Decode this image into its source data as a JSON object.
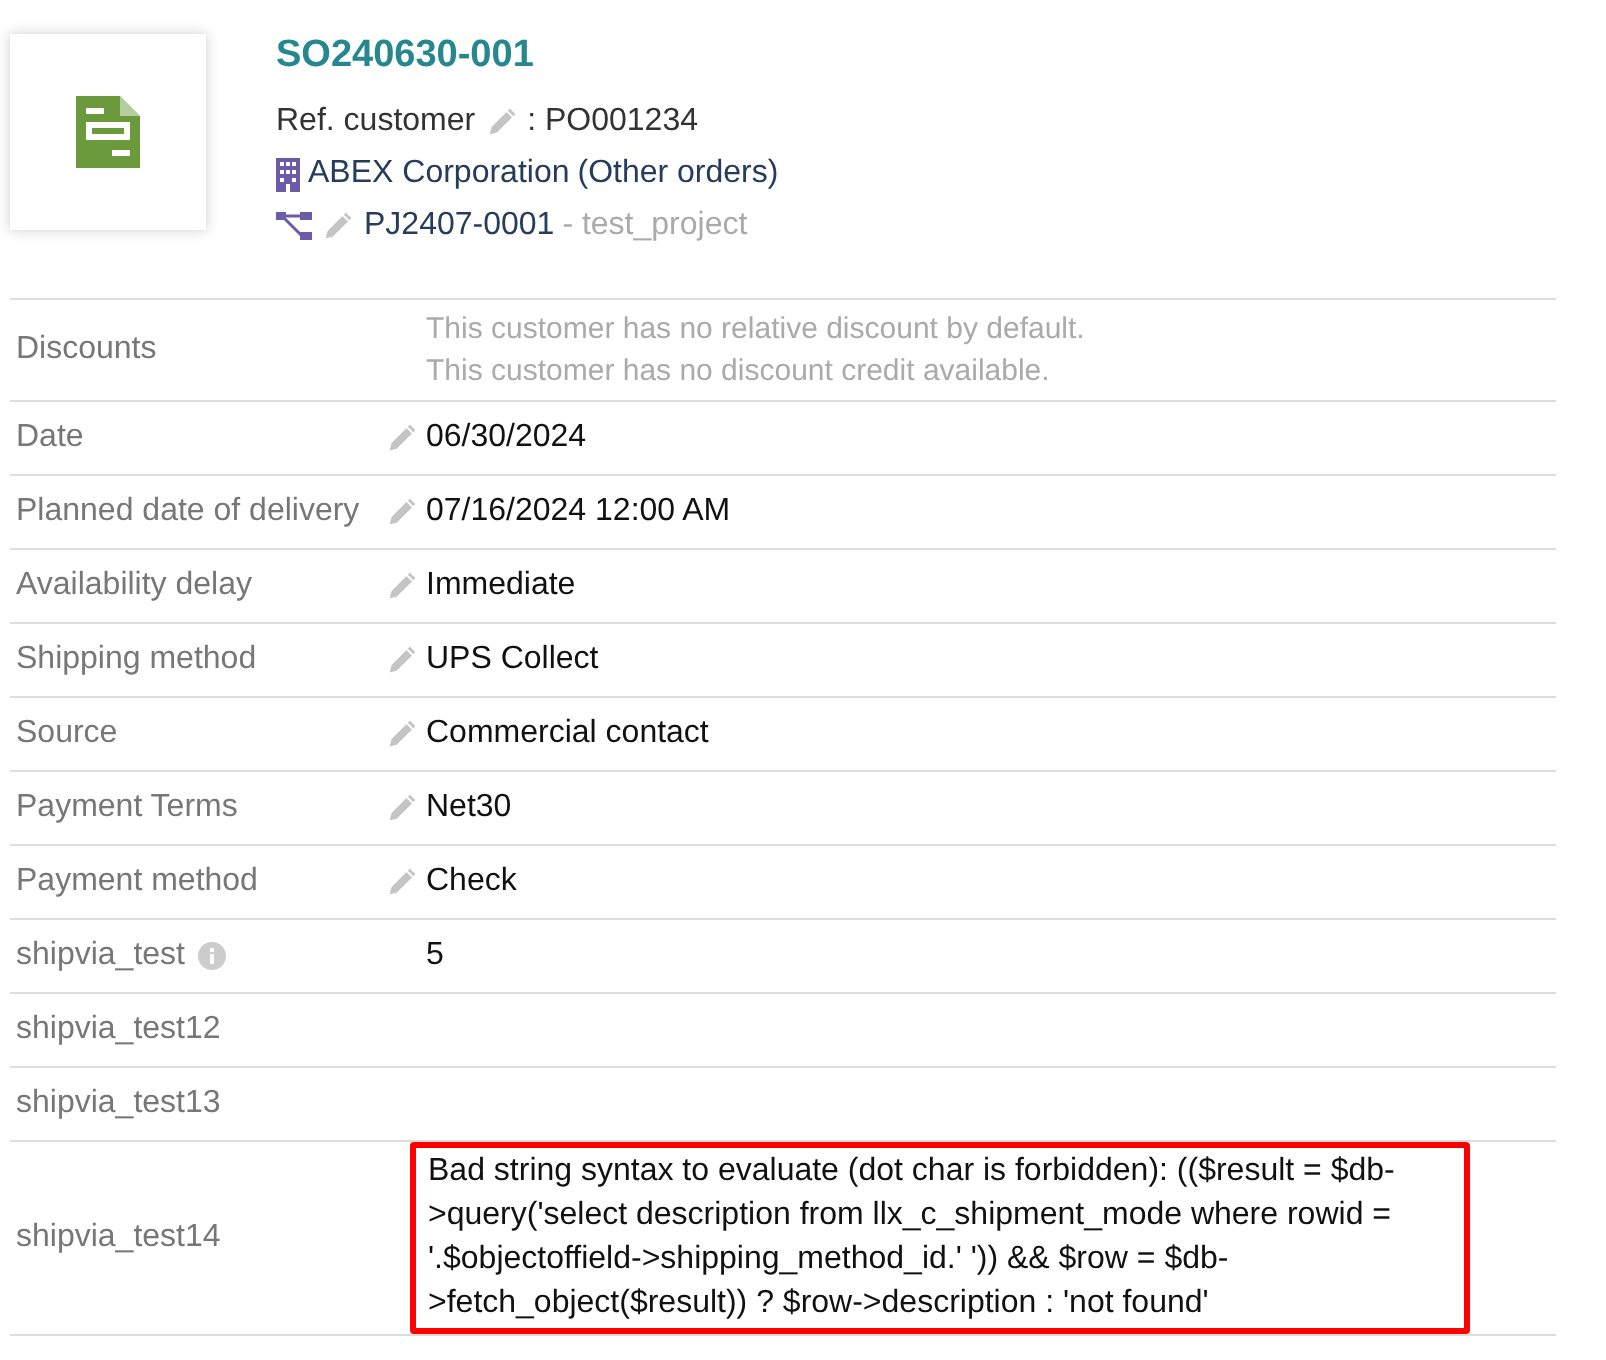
{
  "header": {
    "ref": "SO240630-001",
    "ref_customer_label": "Ref. customer",
    "ref_customer_value": ": PO001234",
    "company": "ABEX Corporation",
    "company_link": "(Other orders)",
    "project": "PJ2407-0001",
    "project_title": "- test_project"
  },
  "fields": [
    {
      "label": "Discounts",
      "kind": "notes",
      "editable": false,
      "info": false,
      "lines": [
        "This customer has no relative discount by default.",
        "This customer has no discount credit available."
      ]
    },
    {
      "label": "Date",
      "kind": "text",
      "editable": true,
      "info": false,
      "value": "06/30/2024"
    },
    {
      "label": "Planned date of delivery",
      "kind": "text",
      "editable": true,
      "info": false,
      "value": "07/16/2024 12:00 AM"
    },
    {
      "label": "Availability delay",
      "kind": "text",
      "editable": true,
      "info": false,
      "value": "Immediate"
    },
    {
      "label": "Shipping method",
      "kind": "text",
      "editable": true,
      "info": false,
      "value": "UPS Collect"
    },
    {
      "label": "Source",
      "kind": "text",
      "editable": true,
      "info": false,
      "value": "Commercial contact"
    },
    {
      "label": "Payment Terms",
      "kind": "text",
      "editable": true,
      "info": false,
      "value": "Net30"
    },
    {
      "label": "Payment method",
      "kind": "text",
      "editable": true,
      "info": false,
      "value": "Check"
    },
    {
      "label": "shipvia_test",
      "kind": "text",
      "editable": false,
      "info": true,
      "value": "5"
    },
    {
      "label": "shipvia_test12",
      "kind": "empty",
      "editable": false,
      "info": false
    },
    {
      "label": "shipvia_test13",
      "kind": "empty",
      "editable": false,
      "info": false
    },
    {
      "label": "shipvia_test14",
      "kind": "error",
      "editable": false,
      "info": false,
      "value": "Bad string syntax to evaluate (dot char is forbidden): (($result = $db->query('select description from llx_c_shipment_mode where rowid = '.$objectoffield->shipping_method_id.' ')) && $row = $db->fetch_object($result)) ? $row->description : 'not found'"
    }
  ]
}
